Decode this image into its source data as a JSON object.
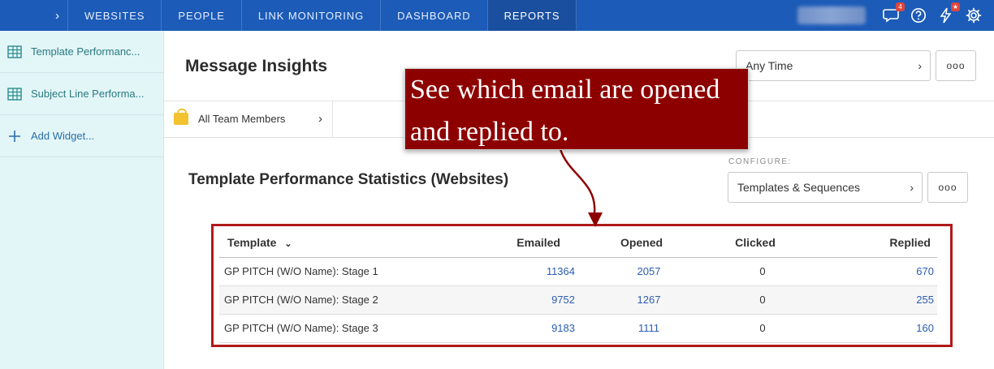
{
  "topnav": {
    "items": [
      {
        "label": "WEBSITES",
        "active": false
      },
      {
        "label": "PEOPLE",
        "active": false
      },
      {
        "label": "LINK MONITORING",
        "active": false
      },
      {
        "label": "DASHBOARD",
        "active": false
      },
      {
        "label": "REPORTS",
        "active": true
      }
    ],
    "icons": {
      "messages": {
        "icon": "chat-bubble-icon",
        "badge": "4"
      },
      "help": {
        "icon": "question-icon"
      },
      "notifications": {
        "icon": "bolt-icon",
        "badge": "★"
      },
      "settings": {
        "icon": "gear-icon"
      }
    },
    "colors": {
      "bar": "#1c5bb8",
      "active": "#1a4f9f",
      "badge": "#e0463c"
    }
  },
  "sidebar": {
    "items": [
      {
        "label": "Template Performanc...",
        "icon": "table-icon"
      },
      {
        "label": "Subject Line Performa...",
        "icon": "table-icon"
      },
      {
        "label": "Add Widget...",
        "icon": "plus-icon"
      }
    ]
  },
  "main": {
    "title": "Message Insights",
    "time_filter": "Any Time",
    "more_label": "ooo",
    "team_filter": "All Team Members",
    "section_title": "Template Performance Statistics (Websites)",
    "configure_label": "CONFIGURE:",
    "configure_value": "Templates & Sequences"
  },
  "table": {
    "headers": {
      "template": "Template",
      "emailed": "Emailed",
      "opened": "Opened",
      "clicked": "Clicked",
      "replied": "Replied"
    },
    "rows": [
      {
        "template": "GP PITCH (W/O Name): Stage 1",
        "emailed": "11364",
        "opened": "2057",
        "clicked": "0",
        "replied": "670"
      },
      {
        "template": "GP PITCH (W/O Name): Stage 2",
        "emailed": "9752",
        "opened": "1267",
        "clicked": "0",
        "replied": "255"
      },
      {
        "template": "GP PITCH (W/O Name): Stage 3",
        "emailed": "9183",
        "opened": "1111",
        "clicked": "0",
        "replied": "160"
      }
    ]
  },
  "annotation": {
    "line1": "See which email are opened",
    "line2": "and replied to.",
    "color": "#8d0000"
  }
}
